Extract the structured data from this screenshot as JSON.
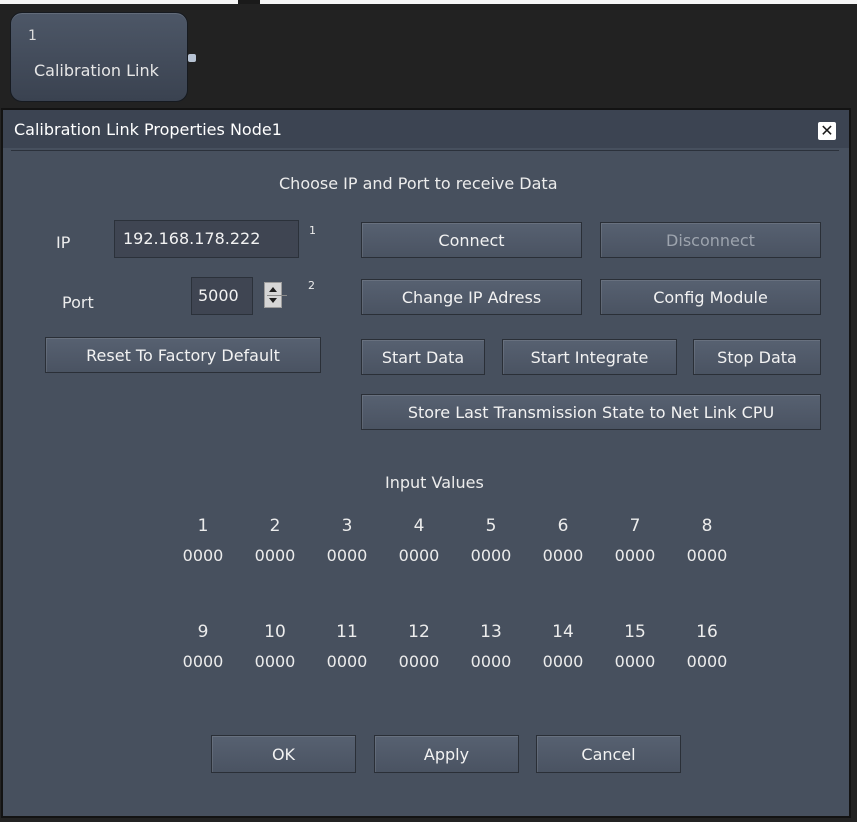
{
  "node": {
    "number": "1",
    "label": "Calibration Link"
  },
  "dialog": {
    "title": "Calibration Link Properties Node1",
    "close_glyph": "✕",
    "header": "Choose IP and Port to receive Data",
    "ip": {
      "label": "IP",
      "value": "192.168.178.222",
      "badge": "1"
    },
    "port": {
      "label": "Port",
      "value": "5000",
      "badge": "2"
    },
    "buttons": {
      "connect": "Connect",
      "disconnect": "Disconnect",
      "change_ip": "Change IP Adress",
      "config_module": "Config Module",
      "reset": "Reset To Factory Default",
      "start_data": "Start Data",
      "start_integrate": "Start Integrate",
      "stop_data": "Stop Data",
      "store_state": "Store Last Transmission State to Net Link CPU"
    },
    "input_values": {
      "title": "Input Values",
      "row1": [
        {
          "index": "1",
          "value": "0000"
        },
        {
          "index": "2",
          "value": "0000"
        },
        {
          "index": "3",
          "value": "0000"
        },
        {
          "index": "4",
          "value": "0000"
        },
        {
          "index": "5",
          "value": "0000"
        },
        {
          "index": "6",
          "value": "0000"
        },
        {
          "index": "7",
          "value": "0000"
        },
        {
          "index": "8",
          "value": "0000"
        }
      ],
      "row2": [
        {
          "index": "9",
          "value": "0000"
        },
        {
          "index": "10",
          "value": "0000"
        },
        {
          "index": "11",
          "value": "0000"
        },
        {
          "index": "12",
          "value": "0000"
        },
        {
          "index": "13",
          "value": "0000"
        },
        {
          "index": "14",
          "value": "0000"
        },
        {
          "index": "15",
          "value": "0000"
        },
        {
          "index": "16",
          "value": "0000"
        }
      ]
    },
    "footer": {
      "ok": "OK",
      "apply": "Apply",
      "cancel": "Cancel"
    }
  }
}
